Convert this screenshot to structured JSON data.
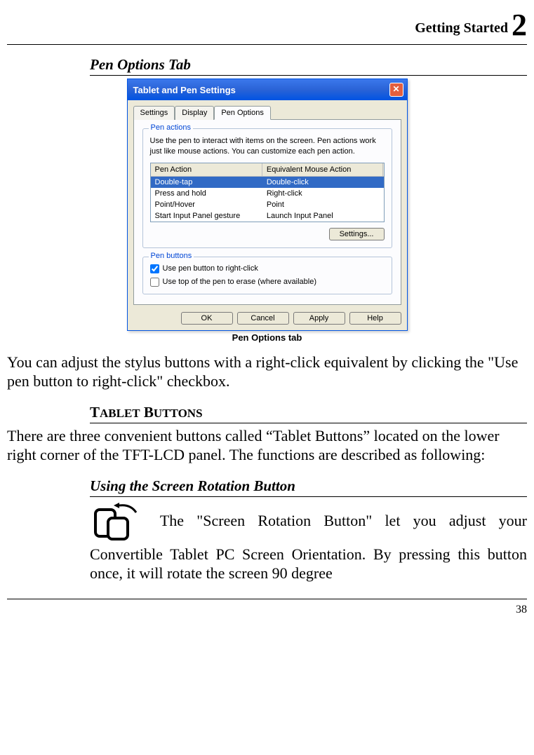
{
  "header": {
    "chapter_title": "Getting Started ",
    "chapter_num": "2"
  },
  "section1": {
    "title": "Pen Options Tab"
  },
  "dialog": {
    "title": "Tablet and Pen Settings",
    "tabs": {
      "settings": "Settings",
      "display": "Display",
      "pen_options": "Pen Options"
    },
    "group1": {
      "label": "Pen actions",
      "desc": "Use the pen to interact with items on the screen. Pen actions work just like mouse actions. You can customize each pen action.",
      "headers": {
        "col1": "Pen Action",
        "col2": "Equivalent Mouse Action"
      },
      "rows": [
        {
          "action": "Double-tap",
          "equiv": "Double-click"
        },
        {
          "action": "Press and hold",
          "equiv": "Right-click"
        },
        {
          "action": "Point/Hover",
          "equiv": "Point"
        },
        {
          "action": "Start Input Panel gesture",
          "equiv": "Launch Input Panel"
        }
      ],
      "settings_btn": "Settings..."
    },
    "group2": {
      "label": "Pen buttons",
      "cb1": "Use pen button to right-click",
      "cb2": "Use top of the pen to erase (where available)"
    },
    "buttons": {
      "ok": "OK",
      "cancel": "Cancel",
      "apply": "Apply",
      "help": "Help"
    }
  },
  "caption": "Pen Options tab",
  "para1": "You can adjust the stylus buttons with a right-click equivalent by clicking the \"Use pen button to right-click\" checkbox.",
  "heading2": "Tablet Buttons",
  "para2": "There are three convenient buttons called “Tablet Buttons” located on the lower right corner of the TFT-LCD panel. The functions are described as following:",
  "section3": {
    "title": "Using the Screen Rotation Button",
    "text": " The \"Screen Rotation Button\" let you adjust your Convertible Tablet PC Screen Orientation.  By  pressing this button once, it will   rotate the screen 90 degree"
  },
  "page_number": "38"
}
